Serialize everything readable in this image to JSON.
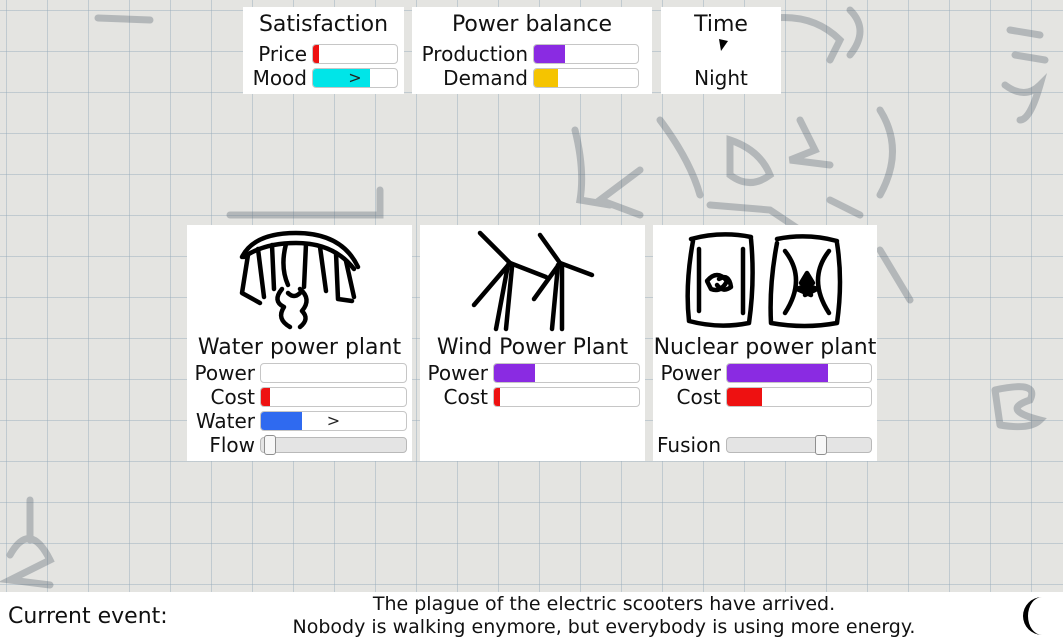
{
  "satisfaction": {
    "title": "Satisfaction",
    "price": {
      "label": "Price",
      "level": 0.07,
      "color": "#ee1111"
    },
    "mood": {
      "label": "Mood",
      "level": 0.68,
      "color": "#00e5e8",
      "arrow": ">"
    }
  },
  "power_balance": {
    "title": "Power balance",
    "production": {
      "label": "Production",
      "level": 0.3,
      "color": "#8a2be2"
    },
    "demand": {
      "label": "Demand",
      "level": 0.23,
      "color": "#f5c400"
    }
  },
  "time": {
    "title": "Time",
    "value": "Night"
  },
  "plants": {
    "water": {
      "name": "Water power plant",
      "power": {
        "label": "Power",
        "level": 0.0,
        "color": "#8a2be2"
      },
      "cost": {
        "label": "Cost",
        "level": 0.06,
        "color": "#ee1111"
      },
      "water": {
        "label": "Water",
        "level": 0.28,
        "color": "#2f6af0",
        "arrow": ">"
      },
      "flow": {
        "label": "Flow",
        "level": 0.02
      }
    },
    "wind": {
      "name": "Wind Power Plant",
      "power": {
        "label": "Power",
        "level": 0.28,
        "color": "#8a2be2"
      },
      "cost": {
        "label": "Cost",
        "level": 0.04,
        "color": "#ee1111"
      }
    },
    "nuclear": {
      "name": "Nuclear power plant",
      "power": {
        "label": "Power",
        "level": 0.7,
        "color": "#8a2be2"
      },
      "cost": {
        "label": "Cost",
        "level": 0.24,
        "color": "#ee1111"
      },
      "fusion": {
        "label": "Fusion",
        "level": 0.67
      }
    }
  },
  "event": {
    "label": "Current event:",
    "line1": "The plague of the electric scooters have arrived.",
    "line2": "Nobody is walking enymore, but everybody is using more energy."
  },
  "icons": {
    "water_plant": "hand-drawn-dam-icon",
    "wind_plant": "hand-drawn-wind-turbines-icon",
    "nuclear_plant": "hand-drawn-nuclear-barrels-icon",
    "clock": "clock-hand-icon",
    "moon": "half-moon-icon"
  }
}
